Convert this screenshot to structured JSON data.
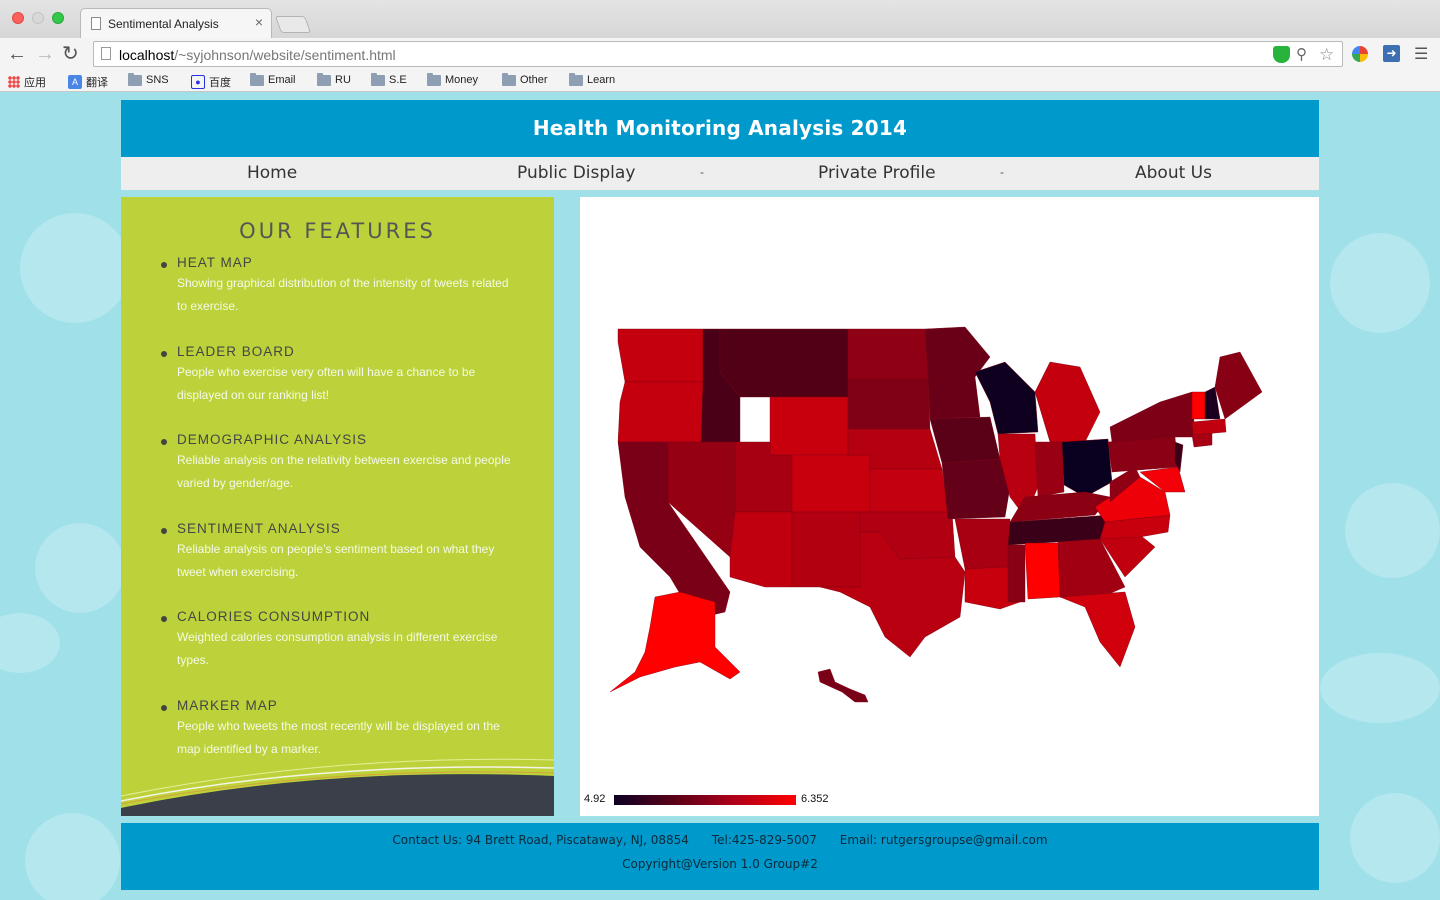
{
  "browser": {
    "tab_title": "Sentimental Analysis",
    "tab_close": "×",
    "url_host": "localhost",
    "url_path": "/~syjohnson/website/sentiment.html",
    "bookmarks": [
      "应用",
      "翻译",
      "SNS",
      "百度",
      "Email",
      "RU",
      "S.E",
      "Money",
      "Other",
      "Learn"
    ]
  },
  "site": {
    "title": "Health Monitoring Analysis 2014",
    "nav": [
      "Home",
      "Public Display",
      "Private Profile",
      "About Us"
    ],
    "nav_separator": "-"
  },
  "features": {
    "heading": "OUR FEATURES",
    "items": [
      {
        "title": "HEAT MAP",
        "desc": "Showing graphical distribution of the intensity of tweets related to exercise."
      },
      {
        "title": "LEADER BOARD",
        "desc": "People who exercise very often will have a chance to be displayed on our ranking list!"
      },
      {
        "title": "DEMOGRAPHIC ANALYSIS",
        "desc": "Reliable analysis on the relativity between exercise and people varied by gender/age."
      },
      {
        "title": "SENTIMENT ANALYSIS",
        "desc": "Reliable analysis on people’s sentiment based on what they tweet when exercising."
      },
      {
        "title": "CALORIES CONSUMPTION",
        "desc": "Weighted calories consumption analysis in different exercise types."
      },
      {
        "title": "MARKER MAP",
        "desc": "People who tweets the most recently will be displayed on the map identified by a marker."
      }
    ]
  },
  "map": {
    "legend_min": "4.92",
    "legend_max": "6.352",
    "colors": {
      "low": "#0d0024",
      "mid": "#8b0016",
      "high": "#ff0000"
    }
  },
  "footer": {
    "contact": "Contact Us: 94 Brett Road, Piscataway, NJ, 08854      Tel:425-829-5007      Email: rutgersgroupse@gmail.com",
    "copyright": "Copyright@Version 1.0 Group#2"
  }
}
